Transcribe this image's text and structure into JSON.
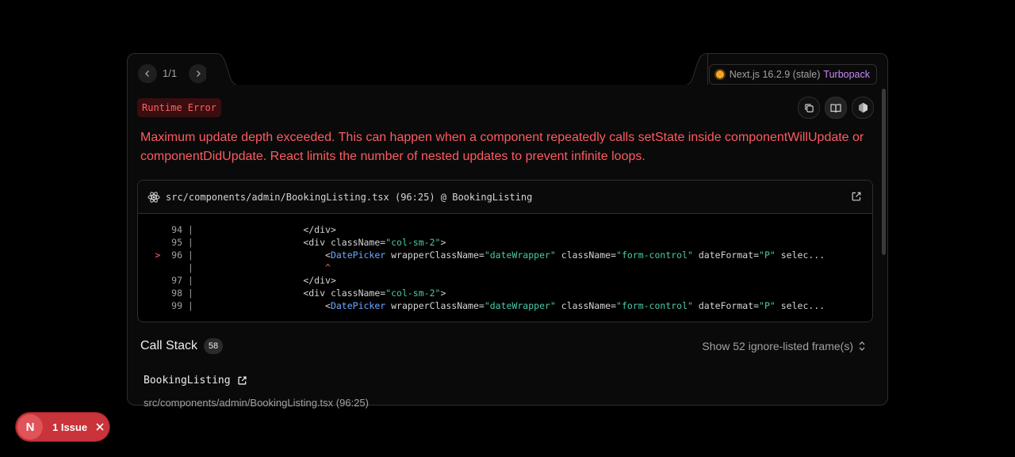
{
  "nav": {
    "prev_icon": "chevron-left-icon",
    "next_icon": "chevron-right-icon",
    "count": "1/1"
  },
  "version": {
    "label": "Next.js 16.2.9 (stale)",
    "bundler": "Turbopack",
    "status_color": "#f5a623"
  },
  "error": {
    "label": "Runtime Error",
    "message_line1": "Maximum update depth exceeded. This can happen when a component repeatedly calls setState inside componentWillUpdate or",
    "message_line2": "componentDidUpdate. React limits the number of nested updates to prevent infinite loops.",
    "color": "#ff5b61"
  },
  "toolbar": {
    "copy_icon": "copy-icon",
    "docs_icon": "book-icon",
    "node_icon": "node-icon"
  },
  "code_frame": {
    "file": "src/components/admin/BookingListing.tsx (96:25) @ BookingListing",
    "lines": [
      {
        "num": "94",
        "marker": " ",
        "indent": "                    ",
        "parts": [
          [
            "t",
            "</div>"
          ]
        ]
      },
      {
        "num": "95",
        "marker": " ",
        "indent": "                    ",
        "parts": [
          [
            "t",
            "<div className="
          ],
          [
            "s",
            "\"col-sm-2\""
          ],
          [
            "t",
            ">"
          ]
        ]
      },
      {
        "num": "96",
        "marker": ">",
        "indent": "                        ",
        "parts": [
          [
            "t",
            "<"
          ],
          [
            "g",
            "DatePicker"
          ],
          [
            "t",
            " wrapperClassName="
          ],
          [
            "s",
            "\"dateWrapper\""
          ],
          [
            "t",
            " className="
          ],
          [
            "s",
            "\"form-control\""
          ],
          [
            "t",
            " dateFormat="
          ],
          [
            "s",
            "\"P\""
          ],
          [
            "t",
            " selec..."
          ]
        ]
      },
      {
        "num": "",
        "marker": " ",
        "indent": "                        ",
        "parts": [
          [
            "c",
            "^"
          ]
        ]
      },
      {
        "num": "97",
        "marker": " ",
        "indent": "                    ",
        "parts": [
          [
            "t",
            "</div>"
          ]
        ]
      },
      {
        "num": "98",
        "marker": " ",
        "indent": "                    ",
        "parts": [
          [
            "t",
            "<div className="
          ],
          [
            "s",
            "\"col-sm-2\""
          ],
          [
            "t",
            ">"
          ]
        ]
      },
      {
        "num": "99",
        "marker": " ",
        "indent": "                        ",
        "parts": [
          [
            "t",
            "<"
          ],
          [
            "g",
            "DatePicker"
          ],
          [
            "t",
            " wrapperClassName="
          ],
          [
            "s",
            "\"dateWrapper\""
          ],
          [
            "t",
            " className="
          ],
          [
            "s",
            "\"form-control\""
          ],
          [
            "t",
            " dateFormat="
          ],
          [
            "s",
            "\"P\""
          ],
          [
            "t",
            " selec..."
          ]
        ]
      }
    ]
  },
  "call_stack": {
    "title": "Call Stack",
    "count": "58",
    "ignore_toggle": "Show 52 ignore-listed frame(s)",
    "frames": [
      {
        "fn": "BookingListing",
        "file": "src/components/admin/BookingListing.tsx (96:25)"
      }
    ]
  },
  "issue_badge": {
    "logo": "N",
    "label": "1 Issue",
    "color": "#c9333a"
  }
}
